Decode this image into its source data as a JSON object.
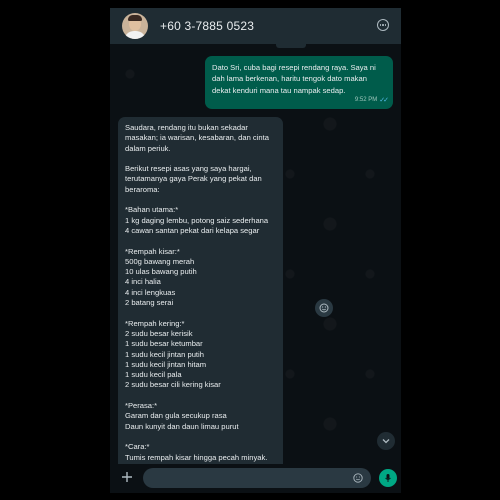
{
  "header": {
    "contact_name": "+60 3-7885 0523",
    "avatar_icon": "contact-photo",
    "menu_icon": "more-options-icon"
  },
  "messages": {
    "outgoing": {
      "text": "Dato Sri, cuba bagi resepi rendang raya. Saya ni dah lama berkenan, haritu tengok dato makan dekat kenduri mana tau nampak sedap.",
      "time": "9:52 PM",
      "status_icon": "double-check-icon"
    },
    "incoming": {
      "text": "Saudara, rendang itu bukan sekadar masakan; ia warisan, kesabaran, dan cinta dalam periuk.\n\nBerikut resepi asas yang saya hargai, terutamanya gaya Perak yang pekat dan beraroma:\n\n*Bahan utama:*\n1 kg daging lembu, potong saiz sederhana\n4 cawan santan pekat dari kelapa segar\n\n*Rempah kisar:*\n500g bawang merah\n10 ulas bawang putih\n4 inci halia\n4 inci lengkuas\n2 batang serai\n\n*Rempah kering:*\n2 sudu besar kerisik\n1 sudu besar ketumbar\n1 sudu kecil jintan putih\n1 sudu kecil jintan hitam\n1 sudu kecil pala\n2 sudu besar cili kering kisar\n\n*Perasa:*\nGaram dan gula secukup rasa\nDaun kunyit dan daun limau purut\n\n*Cara:*\nTumis rempah kisar hingga pecah minyak. Masukkan daging, gaul rata. Tuang santan sedikit demi sedikit. Kacau perlahan dengan api kecil selama 3-4 jam sehingga pekat, gelap,"
    }
  },
  "footer": {
    "input_placeholder": "",
    "attach_icon": "plus-icon",
    "emoji_icon": "sticker-icon",
    "mic_icon": "microphone-icon"
  },
  "colors": {
    "outgoing_bubble": "#005c4b",
    "incoming_bubble": "#202c33",
    "accent": "#00a884",
    "background": "#0b1014"
  }
}
